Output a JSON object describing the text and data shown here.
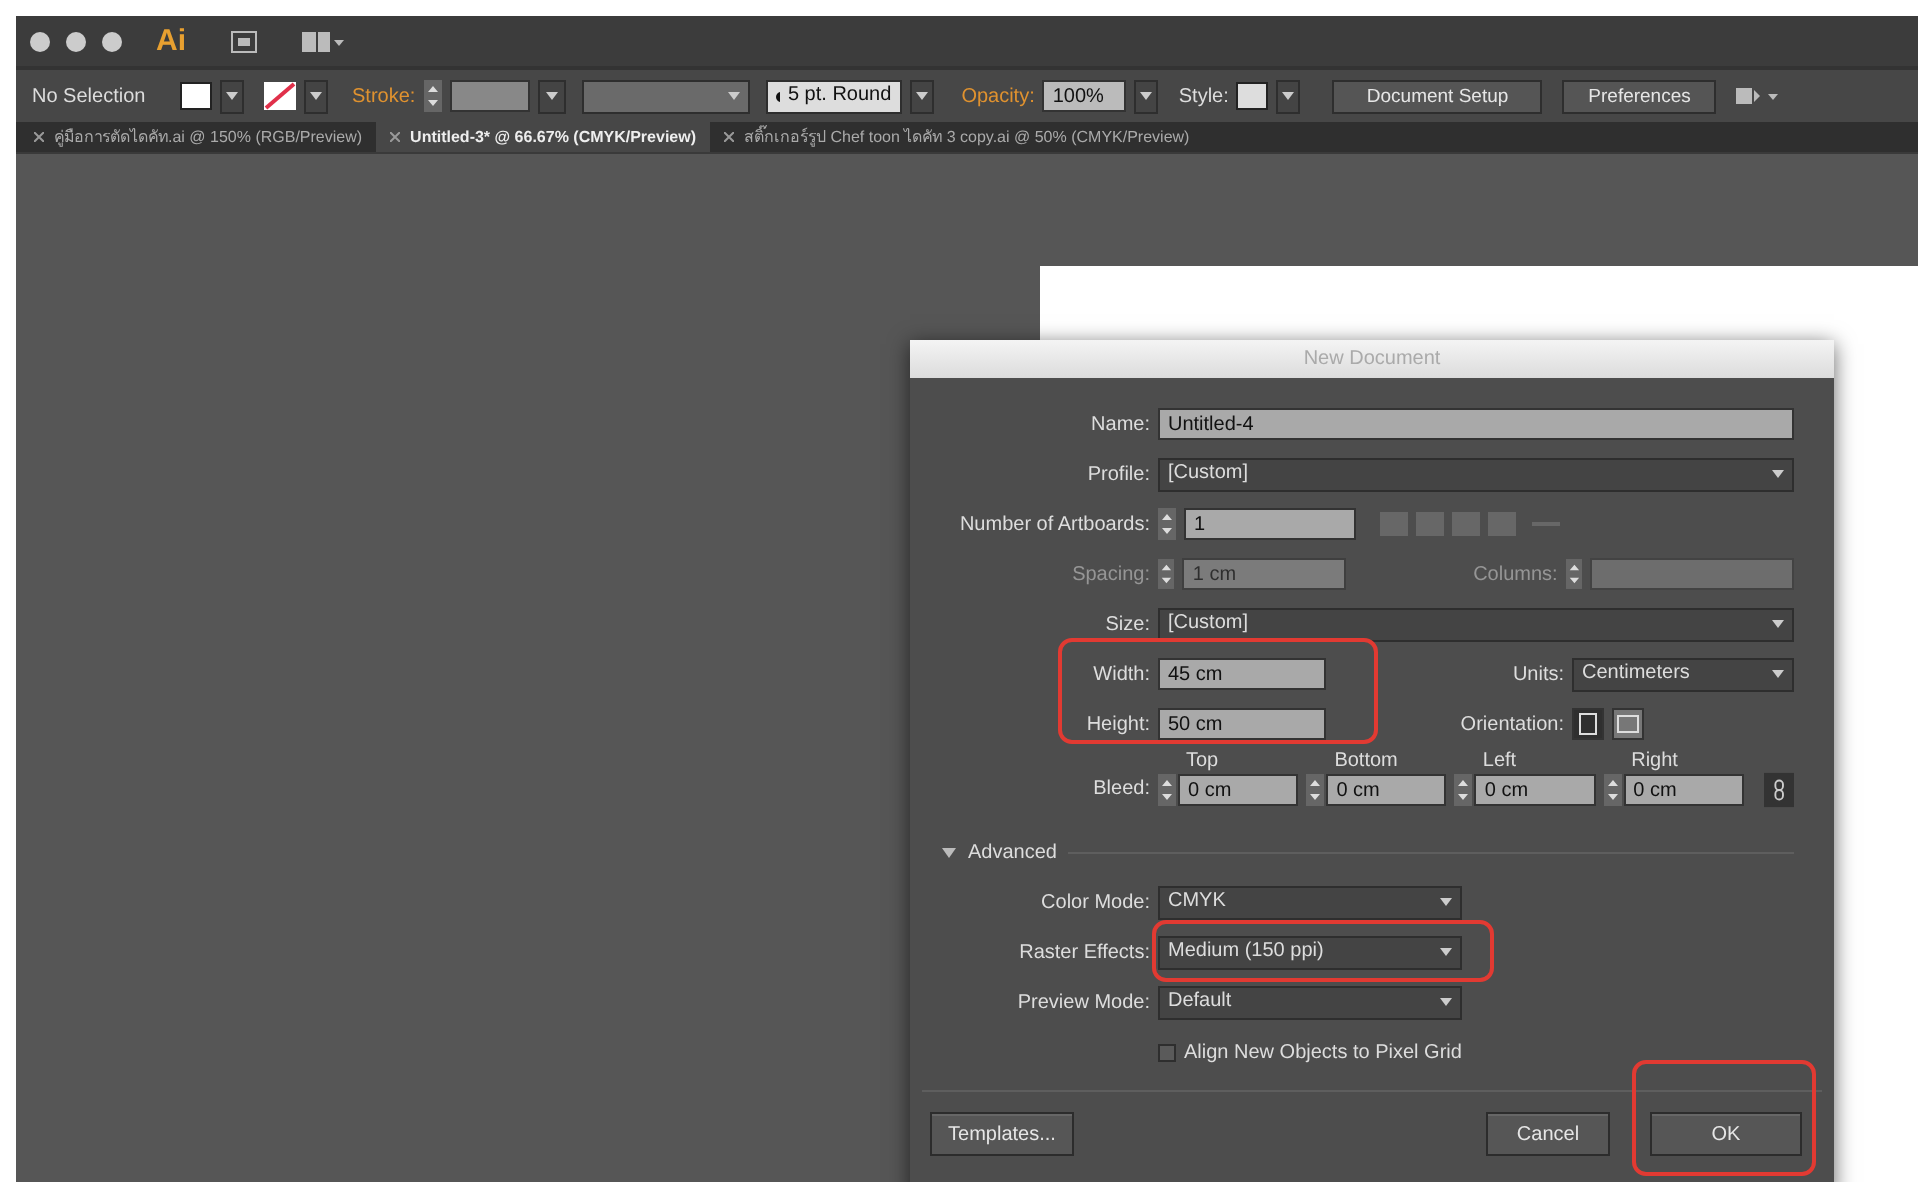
{
  "app": {
    "logo": "Ai"
  },
  "control_bar": {
    "selection": "No Selection",
    "stroke_label": "Stroke:",
    "brush": "5 pt. Round",
    "opacity_label": "Opacity:",
    "opacity": "100%",
    "style_label": "Style:",
    "buttons": [
      "Document Setup",
      "Preferences"
    ]
  },
  "tabs": [
    {
      "label": "คู่มือการตัดไดคัท.ai @ 150% (RGB/Preview)",
      "selected": false
    },
    {
      "label": "Untitled-3* @ 66.67% (CMYK/Preview)",
      "selected": true
    },
    {
      "label": "สติ๊กเกอร์รูป Chef toon ไดคัท 3 copy.ai @ 50% (CMYK/Preview)",
      "selected": false
    }
  ],
  "dialog": {
    "title": "New Document",
    "name": {
      "label": "Name:",
      "value": "Untitled-4"
    },
    "profile": {
      "label": "Profile:",
      "value": "[Custom]"
    },
    "artboards": {
      "label": "Number of Artboards:",
      "value": "1"
    },
    "spacing": {
      "label": "Spacing:",
      "value": "1 cm",
      "disabled": true
    },
    "columns": {
      "label": "Columns:",
      "disabled": true
    },
    "size": {
      "label": "Size:",
      "value": "[Custom]"
    },
    "dimensions": {
      "highlighted": true,
      "fields": [
        {
          "label": "Width:",
          "value": "45 cm"
        },
        {
          "label": "Height:",
          "value": "50 cm"
        }
      ]
    },
    "units": {
      "label": "Units:",
      "value": "Centimeters"
    },
    "orientation": {
      "label": "Orientation:",
      "options": [
        {
          "kind": "portrait",
          "selected": true
        },
        {
          "kind": "landscape",
          "selected": false
        }
      ]
    },
    "bleed": {
      "label": "Bleed:",
      "sides": [
        {
          "label": "Top",
          "value": "0 cm"
        },
        {
          "label": "Bottom",
          "value": "0 cm"
        },
        {
          "label": "Left",
          "value": "0 cm"
        },
        {
          "label": "Right",
          "value": "0 cm"
        }
      ]
    },
    "advanced": {
      "label": "Advanced",
      "expanded": true
    },
    "selects": [
      {
        "label": "Color Mode:",
        "value": "CMYK"
      },
      {
        "label": "Raster Effects:",
        "value": "Medium (150 ppi)",
        "highlighted": true
      },
      {
        "label": "Preview Mode:",
        "value": "Default"
      }
    ],
    "align_grid": {
      "label": "Align New Objects to Pixel Grid",
      "checked": false
    },
    "buttons": [
      {
        "label": "Templates...",
        "kind": "secondary"
      },
      {
        "label": "Cancel",
        "kind": "cancel"
      },
      {
        "label": "OK",
        "kind": "default",
        "highlighted": true
      }
    ]
  }
}
